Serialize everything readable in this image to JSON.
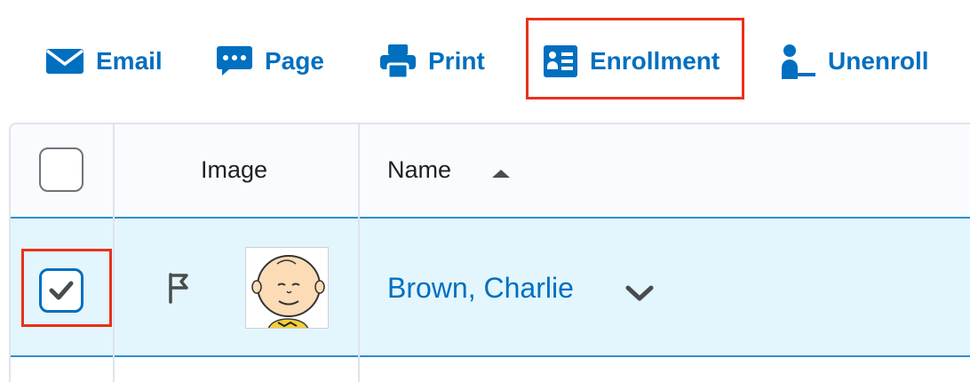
{
  "toolbar": {
    "email_label": "Email",
    "page_label": "Page",
    "print_label": "Print",
    "enrollment_label": "Enrollment",
    "unenroll_label": "Unenroll"
  },
  "colors": {
    "accent": "#006fbf",
    "highlight": "#e8311a",
    "selected_row": "#e3f6fd"
  },
  "table": {
    "headers": {
      "image": "Image",
      "name": "Name"
    },
    "rows": [
      {
        "name": "Brown, Charlie",
        "selected": true
      }
    ]
  }
}
